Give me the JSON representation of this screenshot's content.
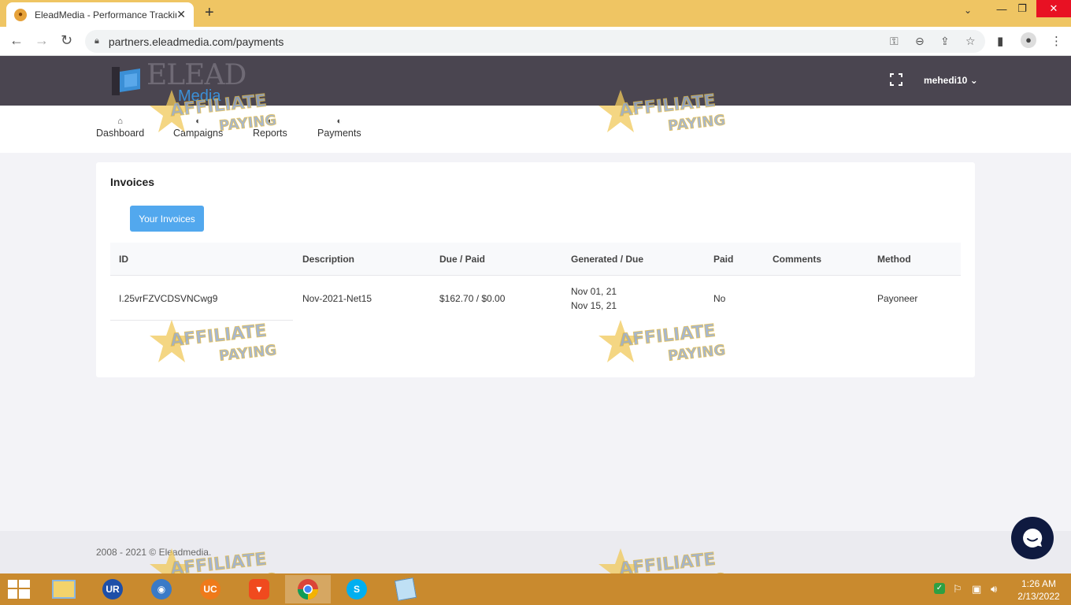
{
  "browser": {
    "tab_title": "EleadMedia - Performance Tracking",
    "url": "partners.eleadmedia.com/payments"
  },
  "header": {
    "logo_top": "ELEAD",
    "logo_bottom": "Media",
    "username": "mehedi10"
  },
  "nav": {
    "items": [
      {
        "label": "Dashboard"
      },
      {
        "label": "Campaigns"
      },
      {
        "label": "Reports"
      },
      {
        "label": "Payments"
      }
    ]
  },
  "invoices": {
    "title": "Invoices",
    "button_label": "Your Invoices",
    "columns": [
      "ID",
      "Description",
      "Due / Paid",
      "Generated / Due",
      "Paid",
      "Comments",
      "Method"
    ],
    "rows": [
      {
        "id": "I.25vrFZVCDSVNCwg9",
        "description": "Nov-2021-Net15",
        "due_paid": "$162.70 / $0.00",
        "generated": "Nov 01, 21",
        "due": "Nov 15, 21",
        "paid": "No",
        "comments": "",
        "method": "Payoneer"
      }
    ]
  },
  "footer": {
    "text": "2008 - 2021 © Eleadmedia."
  },
  "watermark": {
    "line1": "AFFILIATE",
    "line2": "PAYING"
  },
  "taskbar": {
    "time": "1:26 AM",
    "date": "2/13/2022"
  },
  "colors": {
    "tabbar": "#efc563",
    "header": "#4a4550",
    "primary_button": "#52a8ee",
    "chat": "#0f1a40",
    "taskbar": "#c98a2e"
  }
}
